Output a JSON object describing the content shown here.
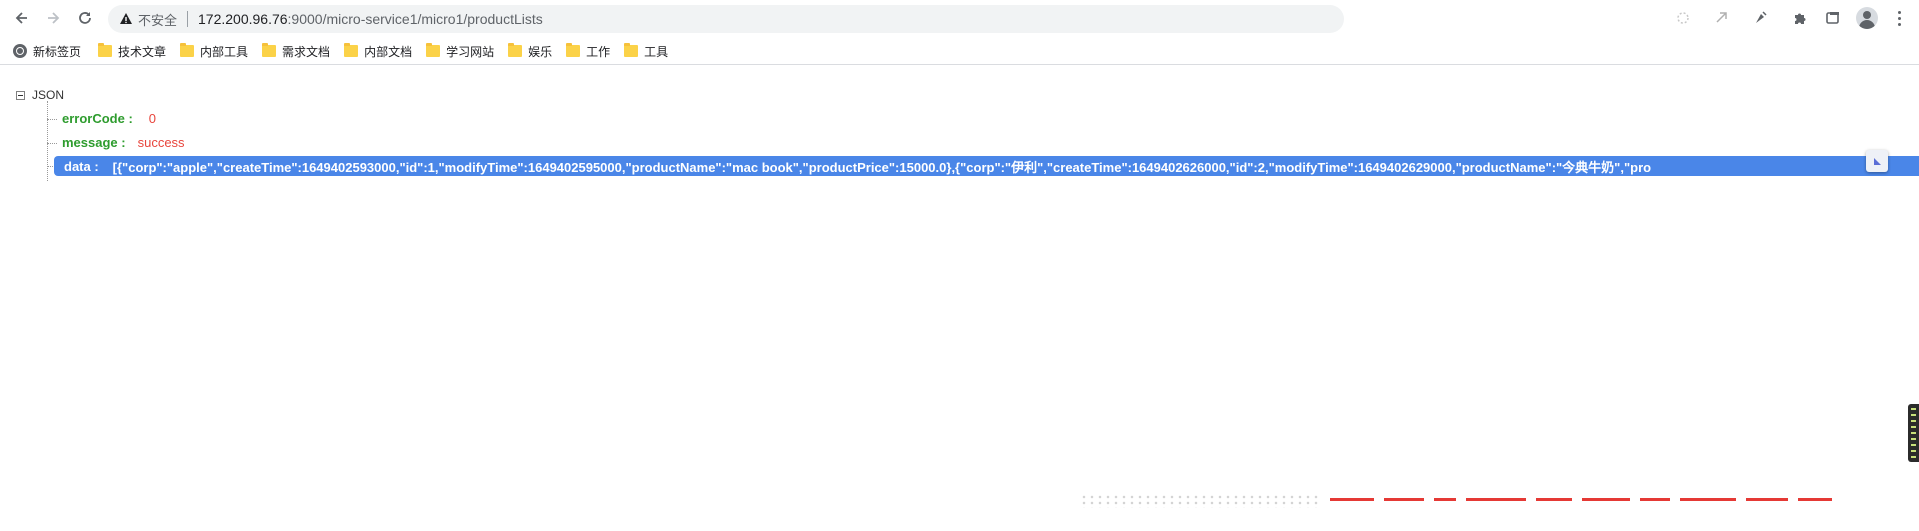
{
  "browser": {
    "omnibox": {
      "security_label": "不安全",
      "url_host": "172.200.96.76",
      "url_rest": ":9000/micro-service1/micro1/productLists"
    },
    "icons": [
      "back-icon",
      "forward-icon",
      "reload-icon",
      "warning-icon",
      "extension-icon",
      "tab-search-icon",
      "profile-icon",
      "menu-icon"
    ]
  },
  "bookmarks": [
    {
      "label": "新标签页",
      "icon": "globe-icon"
    },
    {
      "label": "技术文章",
      "icon": "folder-icon"
    },
    {
      "label": "内部工具",
      "icon": "folder-icon"
    },
    {
      "label": "需求文档",
      "icon": "folder-icon"
    },
    {
      "label": "内部文档",
      "icon": "folder-icon"
    },
    {
      "label": "学习网站",
      "icon": "folder-icon"
    },
    {
      "label": "娱乐",
      "icon": "folder-icon"
    },
    {
      "label": "工作",
      "icon": "folder-icon"
    },
    {
      "label": "工具",
      "icon": "folder-icon"
    }
  ],
  "json_view": {
    "root_label": "JSON",
    "rows": [
      {
        "key": "errorCode :",
        "value": "0"
      },
      {
        "key": "message :",
        "value": "success"
      },
      {
        "key": "data :",
        "value": "[{\"corp\":\"apple\",\"createTime\":1649402593000,\"id\":1,\"modifyTime\":1649402595000,\"productName\":\"mac book\",\"productPrice\":15000.0},{\"corp\":\"伊利\",\"createTime\":1649402626000,\"id\":2,\"modifyTime\":1649402629000,\"productName\":\"今典牛奶\",\"pro"
      }
    ]
  },
  "colors": {
    "json_key": "#2e9c2e",
    "json_value": "#e8453c",
    "selection": "#4a86e8"
  }
}
